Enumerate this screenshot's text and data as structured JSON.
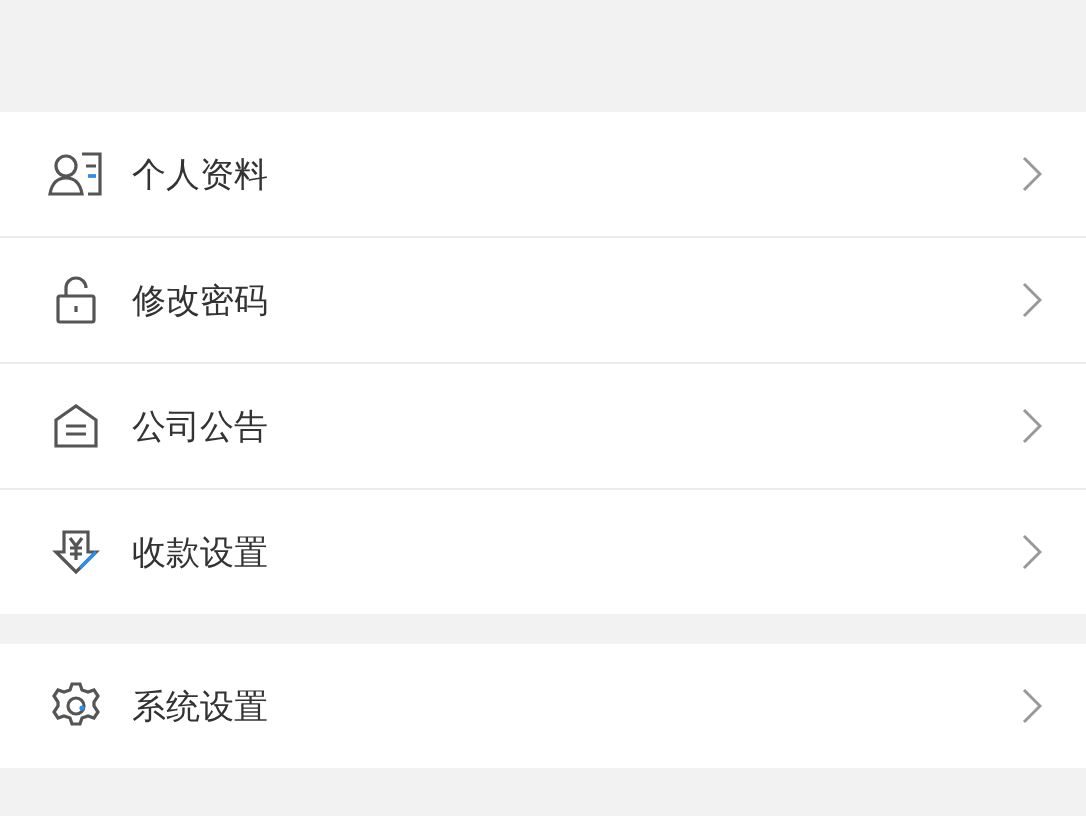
{
  "groups": [
    {
      "items": [
        {
          "label": "个人资料",
          "kind": "profile"
        },
        {
          "label": "修改密码",
          "kind": "password"
        },
        {
          "label": "公司公告",
          "kind": "notice"
        },
        {
          "label": "收款设置",
          "kind": "payment"
        }
      ]
    },
    {
      "items": [
        {
          "label": "系统设置",
          "kind": "system"
        }
      ]
    }
  ]
}
